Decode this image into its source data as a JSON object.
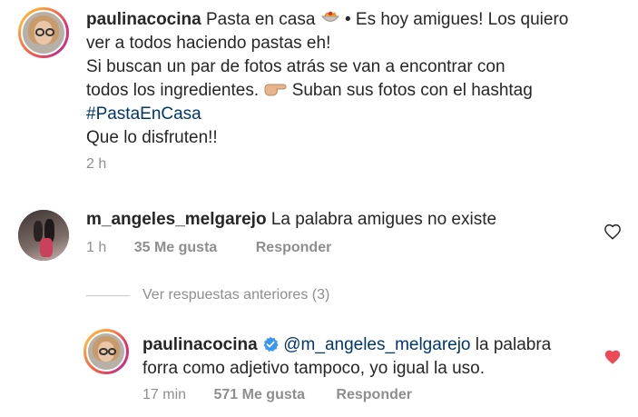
{
  "post": {
    "username": "paulinacocina",
    "caption_line1_a": "Pasta en casa",
    "caption_line1_b": "• Es hoy amigues! Los quiero",
    "caption_line2": "ver a todos haciendo pastas eh!",
    "caption_line3": "Si buscan un par de fotos atrás se van a encontrar con",
    "caption_line4_a": "todos los ingredientes.",
    "caption_line4_b": "Suban sus fotos con el hashtag",
    "hashtag": "#PastaEnCasa",
    "caption_line6": "Que lo disfruten!!",
    "time": "2 h",
    "icons": [
      "spaghetti-emoji",
      "pointing-hand-emoji"
    ]
  },
  "comment": {
    "username": "m_angeles_melgarejo",
    "text": "La palabra amigues no existe",
    "time": "1 h",
    "likes": "35 Me gusta",
    "reply_label": "Responder",
    "liked": false
  },
  "view_replies": "Ver respuestas anteriores (3)",
  "reply": {
    "username": "paulinacocina",
    "mention": "@m_angeles_melgarejo",
    "text_line1": "la palabra",
    "text_line2": "forra como adjetivo tampoco, yo igual la uso.",
    "time": "17 min",
    "likes": "571 Me gusta",
    "reply_label": "Responder",
    "liked": true,
    "verified": true
  },
  "colors": {
    "text": "#262626",
    "secondary": "#8e8e8e",
    "link": "#00376b",
    "heart_liked": "#ed4956",
    "verified": "#3897f0"
  }
}
